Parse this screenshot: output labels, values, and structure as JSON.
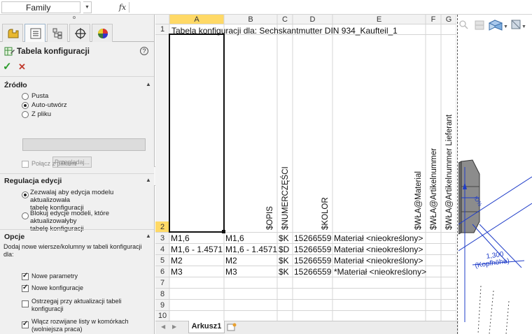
{
  "formula_bar": {
    "name_box": "Family",
    "fx_label": "fx",
    "formula": ""
  },
  "property_manager": {
    "tabs": [
      "feature-manager",
      "property-manager",
      "configuration-manager",
      "dim-xpert-manager",
      "display-manager"
    ],
    "title": "Tabela konfiguracji",
    "help": "?",
    "ok": "✓",
    "cancel": "✕",
    "source": {
      "heading": "Źródło",
      "options": [
        "Pusta",
        "Auto-utwórz",
        "Z pliku"
      ],
      "selected": "Auto-utwórz",
      "file_path": "",
      "browse": "Przeglądaj...",
      "link_file": "Połącz z plikiem"
    },
    "edit_control": {
      "heading": "Regulacja edycji",
      "options": [
        "Zezwalaj aby edycja modelu aktualizowała tabelę konfiguracji",
        "Blokuj edycje modeli, które aktualizowałyby tabelę konfiguracji"
      ],
      "option_lines": [
        [
          "Zezwalaj aby edycja modelu aktualizowała",
          "tabelę konfiguracji"
        ],
        [
          "Blokuj edycje modeli, które aktualizowałyby",
          "tabelę konfiguracji"
        ]
      ],
      "selected": 0
    },
    "options": {
      "heading": "Opcje",
      "intro_lines": [
        "Dodaj nowe wiersze/kolumny w tabeli konfiguracji",
        "dla:"
      ],
      "checkboxes": [
        {
          "label_lines": [
            "Nowe parametry"
          ],
          "checked": true
        },
        {
          "label_lines": [
            "Nowe konfiguracje"
          ],
          "checked": true
        },
        {
          "label_lines": [
            "Ostrzegaj przy aktualizacji tabeli",
            "konfiguracji"
          ],
          "checked": false
        },
        {
          "label_lines": [
            "Włącz rozwijane listy w komórkach",
            "(wolniejsza praca)"
          ],
          "checked": true
        }
      ]
    }
  },
  "spreadsheet": {
    "columns": [
      "A",
      "B",
      "C",
      "D",
      "E",
      "F",
      "G"
    ],
    "row_numbers": [
      "1",
      "2",
      "3",
      "4",
      "5",
      "6",
      "7",
      "8",
      "9",
      "10"
    ],
    "title_cell": "Tabela konfiguracji dla: Sechskantmutter DIN 934_Kaufteil_1",
    "vertical_headers": [
      {
        "col": "B",
        "text": "$OPIS"
      },
      {
        "col": "C",
        "text": "$NUMERCZĘŚCI"
      },
      {
        "col": "D",
        "text": "$KOLOR"
      },
      {
        "col": "E",
        "text": "$WŁA@Material"
      },
      {
        "col": "F",
        "text": "$WŁA@Artikelnummer"
      },
      {
        "col": "G",
        "text": "$WŁA@Artikelnummer Lieferant"
      }
    ],
    "rows": [
      [
        "M1,6",
        "M1,6",
        "$K",
        "15266559",
        "Materiał <nieokreślony>"
      ],
      [
        "M1,6 - 1.4571",
        "M1,6 - 1.4571",
        "$D",
        "15266559",
        "Materiał <nieokreślony>"
      ],
      [
        "M2",
        "M2",
        "$K",
        "15266559",
        "Materiał <nieokreślony>"
      ],
      [
        "M3",
        "M3",
        "$K",
        "15266559",
        "*Materiał <nieokreślony>"
      ]
    ],
    "sheet_tab": "Arkusz1"
  },
  "cad_view": {
    "dimension_value": "1,300",
    "dimension_label": "(Kopfhöhe)",
    "hud_icons": [
      "zoom-icon",
      "section-view-icon",
      "view-orientation-icon",
      "display-style-icon"
    ]
  },
  "colors": {
    "selected_header": "#ffd966",
    "accent_green": "#2c9c2c",
    "cancel_red": "#c0392b",
    "dimension_blue": "#1e3cc8"
  }
}
